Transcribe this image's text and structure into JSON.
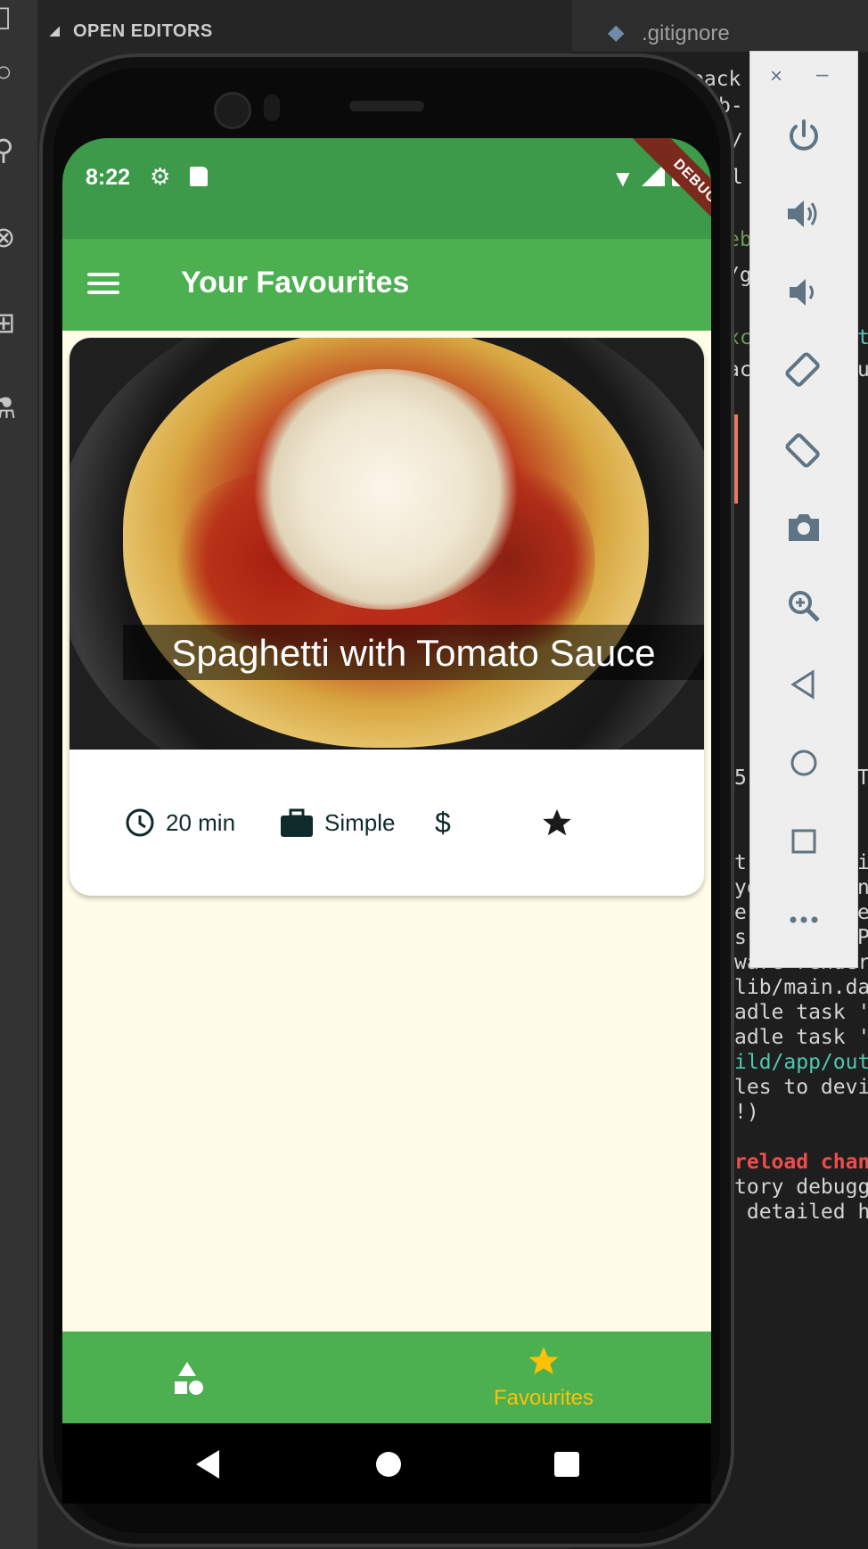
{
  "ide": {
    "open_editors_label": "OPEN EDITORS",
    "tab_label": ".gitignore",
    "code_lines": [
      "pack",
      "b-",
      "b/",
      "il",
      "eb",
      "/g",
      "xc",
      "ac",
      "t",
      "u",
      "5",
      "T",
      "t",
      "i",
      "yo",
      "n",
      "e",
      "e",
      "s-",
      "P",
      "ware render",
      "lib/main.da",
      "adle task '",
      "adle task '",
      "ild/app/out",
      "les to devi",
      "!)",
      "reload chan",
      "tory debugg",
      " detailed h"
    ]
  },
  "emulator": {
    "close_label": "×",
    "minimize_label": "–",
    "buttons": [
      "power-icon",
      "volume-up-icon",
      "volume-down-icon",
      "rotate-left-icon",
      "rotate-right-icon",
      "screenshot-icon",
      "zoom-icon",
      "back-icon",
      "home-icon",
      "overview-icon",
      "more-icon"
    ]
  },
  "phone": {
    "status": {
      "time": "8:22",
      "debug_banner": "DEBUG"
    },
    "appbar": {
      "title": "Your Favourites"
    },
    "meal": {
      "title": "Spaghetti with Tomato Sauce",
      "duration": "20 min",
      "complexity": "Simple",
      "affordability": "$"
    },
    "bottom_nav": {
      "favourites_label": "Favourites",
      "active_color": "#ffc107"
    },
    "colors": {
      "primary": "#4caf50",
      "status_bar": "#3c9a4a",
      "background": "#fffde7"
    }
  }
}
